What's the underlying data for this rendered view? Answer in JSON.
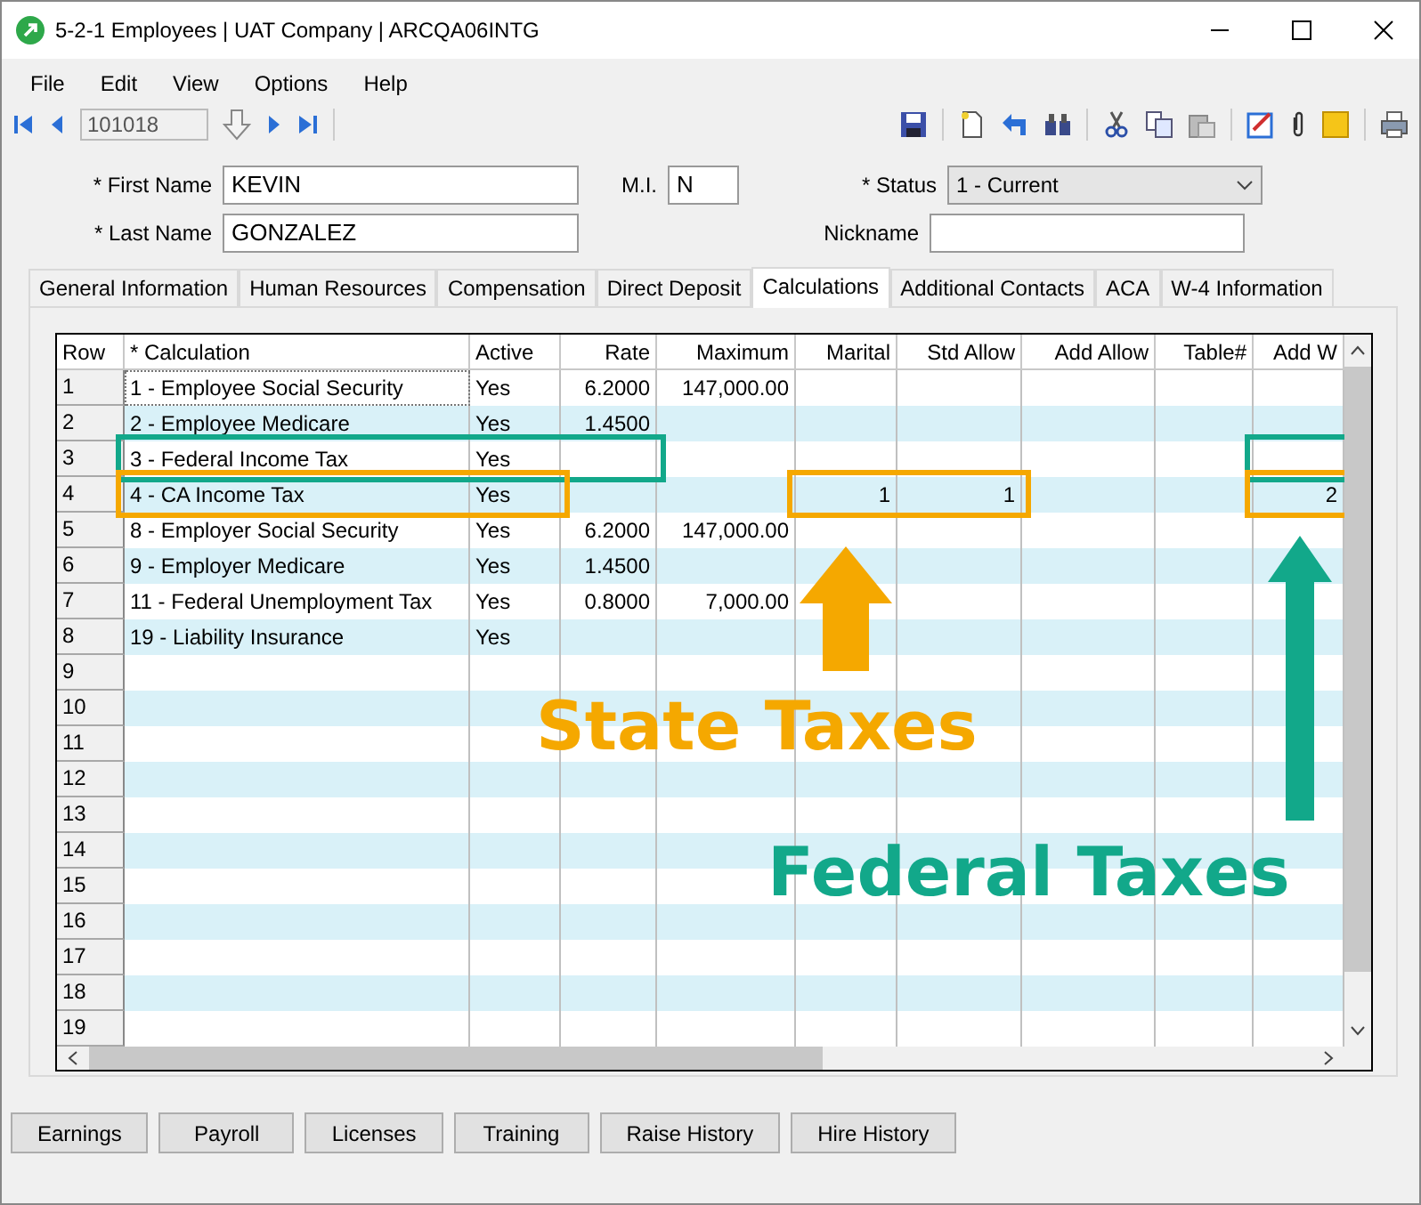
{
  "window": {
    "title": "5-2-1 Employees | UAT Company | ARCQA06INTG"
  },
  "menu": [
    "File",
    "Edit",
    "View",
    "Options",
    "Help"
  ],
  "record_field": {
    "value": "101018"
  },
  "form": {
    "first_name": {
      "label": "* First Name",
      "value": "KEVIN"
    },
    "mi": {
      "label": "M.I.",
      "value": "N"
    },
    "last_name": {
      "label": "* Last Name",
      "value": "GONZALEZ"
    },
    "status": {
      "label": "* Status",
      "value": "1 - Current"
    },
    "nickname": {
      "label": "Nickname"
    }
  },
  "tabs": [
    {
      "label": "General Information",
      "selected": false
    },
    {
      "label": "Human Resources",
      "selected": false
    },
    {
      "label": "Compensation",
      "selected": false
    },
    {
      "label": "Direct Deposit",
      "selected": false
    },
    {
      "label": "Calculations",
      "selected": true
    },
    {
      "label": "Additional Contacts",
      "selected": false
    },
    {
      "label": "ACA",
      "selected": false
    },
    {
      "label": "W-4 Information",
      "selected": false
    }
  ],
  "table": {
    "columns": [
      "Row",
      "* Calculation",
      "Active",
      "Rate",
      "Maximum",
      "Marital",
      "Std Allow",
      "Add Allow",
      "Table#",
      "Add W"
    ],
    "rows": [
      {
        "cells": [
          "1",
          "1 - Employee Social Security",
          "Yes",
          "6.2000",
          "147,000.00",
          null,
          null,
          null,
          null,
          null
        ]
      },
      {
        "cells": [
          "2",
          "2 - Employee Medicare",
          "Yes",
          "1.4500",
          null,
          null,
          null,
          null,
          null,
          null
        ]
      },
      {
        "cells": [
          "3",
          "3 - Federal Income Tax",
          "Yes",
          null,
          null,
          null,
          null,
          null,
          null,
          null
        ]
      },
      {
        "cells": [
          "4",
          "4 - CA Income Tax",
          "Yes",
          null,
          null,
          "1",
          "1",
          null,
          null,
          "2"
        ]
      },
      {
        "cells": [
          "5",
          "8 - Employer Social Security",
          "Yes",
          "6.2000",
          "147,000.00",
          null,
          null,
          null,
          null,
          null
        ]
      },
      {
        "cells": [
          "6",
          "9 - Employer Medicare",
          "Yes",
          "1.4500",
          null,
          null,
          null,
          null,
          null,
          null
        ]
      },
      {
        "cells": [
          "7",
          "11 - Federal Unemployment Tax",
          "Yes",
          "0.8000",
          "7,000.00",
          null,
          null,
          null,
          null,
          null
        ]
      },
      {
        "cells": [
          "8",
          "19 - Liability Insurance",
          "Yes",
          null,
          null,
          null,
          null,
          null,
          null,
          null
        ]
      },
      {
        "cells": [
          "9"
        ]
      },
      {
        "cells": [
          "10"
        ]
      },
      {
        "cells": [
          "11"
        ]
      },
      {
        "cells": [
          "12"
        ]
      },
      {
        "cells": [
          "13"
        ]
      },
      {
        "cells": [
          "14"
        ]
      },
      {
        "cells": [
          "15"
        ]
      },
      {
        "cells": [
          "16"
        ]
      },
      {
        "cells": [
          "17"
        ]
      },
      {
        "cells": [
          "18"
        ]
      },
      {
        "cells": [
          "19"
        ]
      }
    ]
  },
  "annotations": [
    {
      "kind": "federal",
      "label": "Federal Taxes",
      "color": "#12a88a"
    },
    {
      "kind": "state",
      "label": "State Taxes",
      "color": "#f5a800"
    }
  ],
  "buttons": [
    "Earnings",
    "Payroll",
    "Licenses",
    "Training",
    "Raise History",
    "Hire History"
  ]
}
